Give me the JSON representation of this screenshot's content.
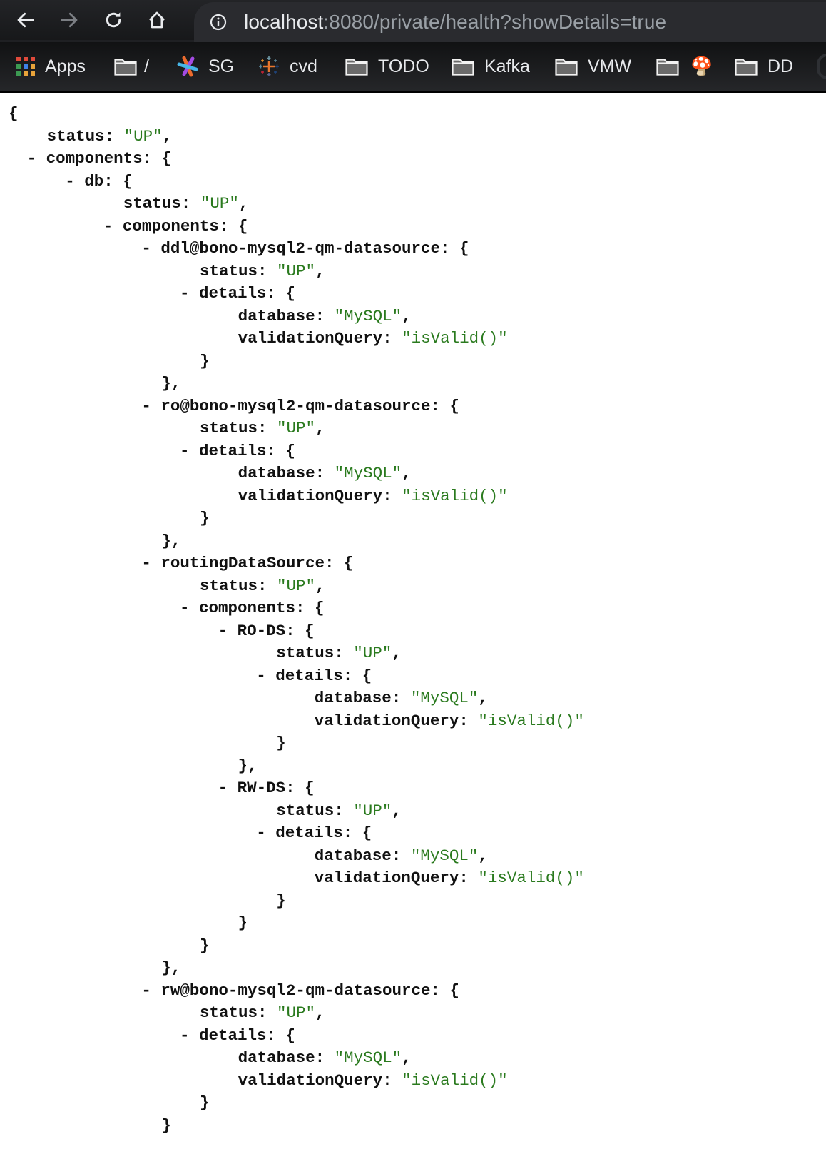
{
  "browser": {
    "url_host": "localhost",
    "url_rest": ":8080/private/health?showDetails=true",
    "nav": {
      "back_icon": "arrow-left-icon",
      "forward_icon": "arrow-right-icon",
      "reload_icon": "reload-icon",
      "home_icon": "home-icon",
      "info_icon": "info-icon"
    },
    "bookmarks": [
      {
        "label": "Apps",
        "icon": "apps-grid-icon"
      },
      {
        "label": "/",
        "icon": "folder-icon"
      },
      {
        "label": "SG",
        "icon": "sg-logo-icon"
      },
      {
        "label": "cvd",
        "icon": "tableau-logo-icon"
      },
      {
        "label": "TODO",
        "icon": "folder-icon"
      },
      {
        "label": "Kafka",
        "icon": "folder-icon"
      },
      {
        "label": "VMW",
        "icon": "folder-icon"
      },
      {
        "label": "🍄",
        "icon": "folder-icon"
      },
      {
        "label": "DD",
        "icon": "folder-icon"
      }
    ]
  },
  "json_view": {
    "collapse_marker": "-",
    "lines": [
      {
        "indent": 0,
        "text": "{"
      },
      {
        "indent": 1,
        "key": "status",
        "value": "\"UP\"",
        "comma": true
      },
      {
        "indent": 1,
        "toggle": true,
        "key": "components",
        "open": "{"
      },
      {
        "indent": 2,
        "toggle": true,
        "key": "db",
        "open": "{"
      },
      {
        "indent": 3,
        "key": "status",
        "value": "\"UP\"",
        "comma": true
      },
      {
        "indent": 3,
        "toggle": true,
        "key": "components",
        "open": "{"
      },
      {
        "indent": 4,
        "toggle": true,
        "key": "ddl@bono-mysql2-qm-datasource",
        "open": "{"
      },
      {
        "indent": 5,
        "key": "status",
        "value": "\"UP\"",
        "comma": true
      },
      {
        "indent": 5,
        "toggle": true,
        "key": "details",
        "open": "{"
      },
      {
        "indent": 6,
        "key": "database",
        "value": "\"MySQL\"",
        "comma": true
      },
      {
        "indent": 6,
        "key": "validationQuery",
        "value": "\"isValid()\""
      },
      {
        "indent": 5,
        "text": "}"
      },
      {
        "indent": 4,
        "text": "},"
      },
      {
        "indent": 4,
        "toggle": true,
        "key": "ro@bono-mysql2-qm-datasource",
        "open": "{"
      },
      {
        "indent": 5,
        "key": "status",
        "value": "\"UP\"",
        "comma": true
      },
      {
        "indent": 5,
        "toggle": true,
        "key": "details",
        "open": "{"
      },
      {
        "indent": 6,
        "key": "database",
        "value": "\"MySQL\"",
        "comma": true
      },
      {
        "indent": 6,
        "key": "validationQuery",
        "value": "\"isValid()\""
      },
      {
        "indent": 5,
        "text": "}"
      },
      {
        "indent": 4,
        "text": "},"
      },
      {
        "indent": 4,
        "toggle": true,
        "key": "routingDataSource",
        "open": "{"
      },
      {
        "indent": 5,
        "key": "status",
        "value": "\"UP\"",
        "comma": true
      },
      {
        "indent": 5,
        "toggle": true,
        "key": "components",
        "open": "{"
      },
      {
        "indent": 6,
        "toggle": true,
        "key": "RO-DS",
        "open": "{"
      },
      {
        "indent": 7,
        "key": "status",
        "value": "\"UP\"",
        "comma": true
      },
      {
        "indent": 7,
        "toggle": true,
        "key": "details",
        "open": "{"
      },
      {
        "indent": 8,
        "key": "database",
        "value": "\"MySQL\"",
        "comma": true
      },
      {
        "indent": 8,
        "key": "validationQuery",
        "value": "\"isValid()\""
      },
      {
        "indent": 7,
        "text": "}"
      },
      {
        "indent": 6,
        "text": "},"
      },
      {
        "indent": 6,
        "toggle": true,
        "key": "RW-DS",
        "open": "{"
      },
      {
        "indent": 7,
        "key": "status",
        "value": "\"UP\"",
        "comma": true
      },
      {
        "indent": 7,
        "toggle": true,
        "key": "details",
        "open": "{"
      },
      {
        "indent": 8,
        "key": "database",
        "value": "\"MySQL\"",
        "comma": true
      },
      {
        "indent": 8,
        "key": "validationQuery",
        "value": "\"isValid()\""
      },
      {
        "indent": 7,
        "text": "}"
      },
      {
        "indent": 6,
        "text": "}"
      },
      {
        "indent": 5,
        "text": "}"
      },
      {
        "indent": 4,
        "text": "},"
      },
      {
        "indent": 4,
        "toggle": true,
        "key": "rw@bono-mysql2-qm-datasource",
        "open": "{"
      },
      {
        "indent": 5,
        "key": "status",
        "value": "\"UP\"",
        "comma": true
      },
      {
        "indent": 5,
        "toggle": true,
        "key": "details",
        "open": "{"
      },
      {
        "indent": 6,
        "key": "database",
        "value": "\"MySQL\"",
        "comma": true
      },
      {
        "indent": 6,
        "key": "validationQuery",
        "value": "\"isValid()\""
      },
      {
        "indent": 5,
        "text": "}"
      },
      {
        "indent": 4,
        "text": "}"
      }
    ]
  },
  "colors": {
    "string_value": "#2a7a1e",
    "key": "#111111",
    "chrome_bg": "#1f2023"
  }
}
